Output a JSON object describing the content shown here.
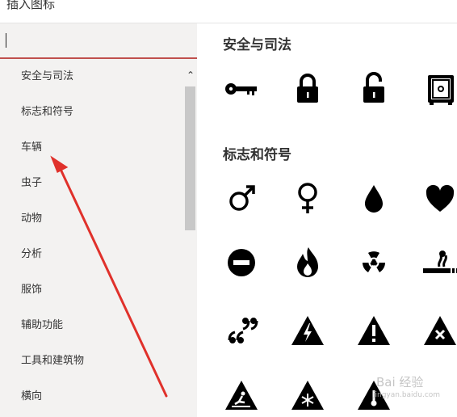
{
  "window": {
    "title": "插入图标"
  },
  "search": {
    "value": "",
    "placeholder": ""
  },
  "categories": [
    "安全与司法",
    "标志和符号",
    "车辆",
    "虫子",
    "动物",
    "分析",
    "服饰",
    "辅助功能",
    "工具和建筑物",
    "横向"
  ],
  "sections": [
    {
      "title": "安全与司法",
      "icons": [
        "key-icon",
        "lock-icon",
        "unlock-icon",
        "safe-icon"
      ]
    },
    {
      "title": "标志和符号",
      "icons": [
        "male-icon",
        "female-icon",
        "drop-icon",
        "heart-icon",
        "no-entry-icon",
        "fire-icon",
        "radiation-icon",
        "smoking-icon",
        "quote-icon",
        "high-voltage-icon",
        "exclamation-warning-icon",
        "x-warning-icon",
        "slippery-warning-icon",
        "snowflake-warning-icon",
        "thermometer-warning-icon"
      ]
    }
  ],
  "colors": {
    "accent": "#c0504d",
    "arrow": "#e0312b"
  },
  "watermark": {
    "text": "Bai 经验",
    "sub": "jingyan.baidu.com"
  }
}
